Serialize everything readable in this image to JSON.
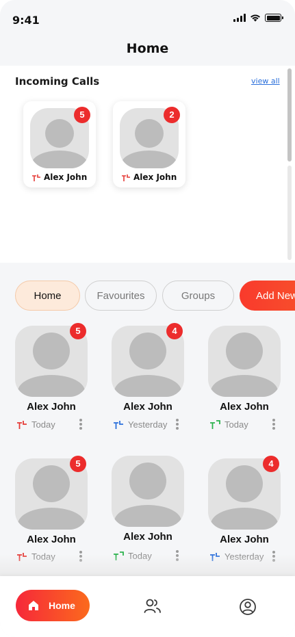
{
  "status_bar": {
    "time": "9:41"
  },
  "header": {
    "title": "Home"
  },
  "incoming": {
    "title": "Incoming Calls",
    "view_all": "view all",
    "cards": [
      {
        "name": "Alex John",
        "badge": "5",
        "call_type": "missed"
      },
      {
        "name": "Alex John",
        "badge": "2",
        "call_type": "missed"
      }
    ]
  },
  "tabs": [
    {
      "label": "Home",
      "active": true
    },
    {
      "label": "Favourites",
      "active": false
    },
    {
      "label": "Groups",
      "active": false
    },
    {
      "label": "Add New",
      "active": false
    }
  ],
  "contacts": [
    {
      "name": "Alex John",
      "when": "Today",
      "badge": "5",
      "call_type": "missed"
    },
    {
      "name": "Alex John",
      "when": "Yesterday",
      "badge": "4",
      "call_type": "outgoing"
    },
    {
      "name": "Alex John",
      "when": "Today",
      "badge": "",
      "call_type": "incoming"
    },
    {
      "name": "Alex John",
      "when": "Today",
      "badge": "5",
      "call_type": "missed"
    },
    {
      "name": "Alex John",
      "when": "Today",
      "badge": "",
      "call_type": "incoming"
    },
    {
      "name": "Alex John",
      "when": "Yesterday",
      "badge": "4",
      "call_type": "outgoing"
    }
  ],
  "bottom_nav": {
    "home_label": "Home",
    "items": [
      "home-icon",
      "contacts-icon",
      "profile-icon"
    ]
  },
  "colors": {
    "accent": "#f7552b",
    "badge": "#ec2c2c",
    "missed": "#e53935",
    "outgoing": "#2a6fdb",
    "incoming": "#2bb24c",
    "link": "#2a6fdb"
  }
}
